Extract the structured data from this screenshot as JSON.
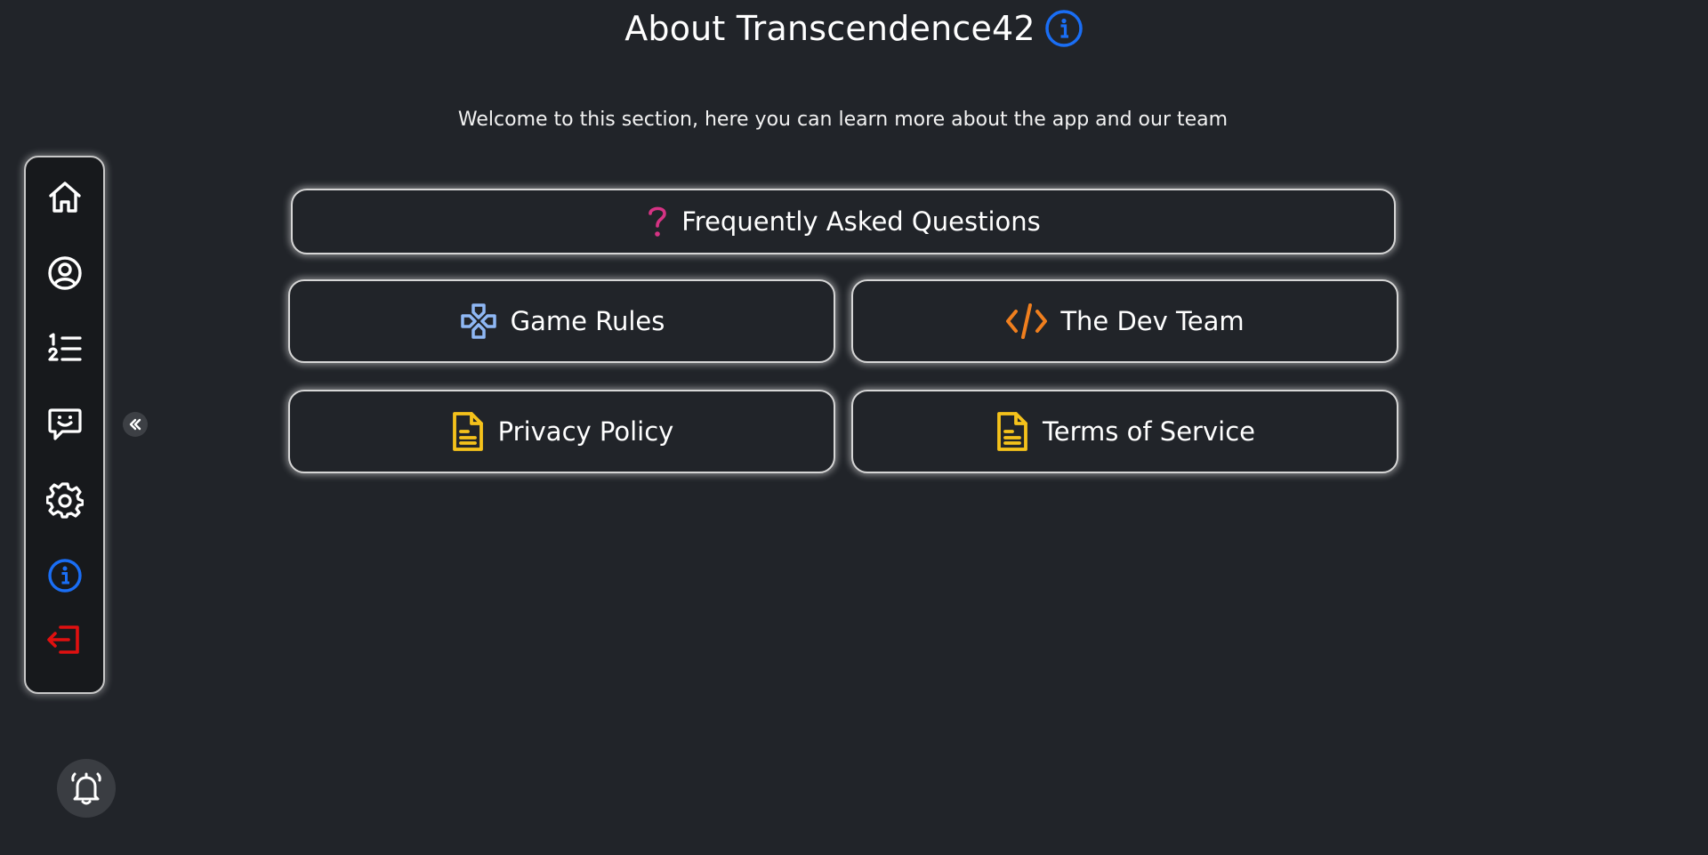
{
  "header": {
    "title": "About Transcendence42",
    "title_icon": "info-circle-icon",
    "subtitle": "Welcome to this section, here you can learn more about the app and our team"
  },
  "cards": {
    "faq": {
      "label": "Frequently Asked Questions",
      "icon": "question-mark-icon",
      "color": "#d63384"
    },
    "game_rules": {
      "label": "Game Rules",
      "icon": "gamepad-icon",
      "color": "#8fb8f5"
    },
    "dev_team": {
      "label": "The Dev Team",
      "icon": "code-icon",
      "color": "#f07f1e"
    },
    "privacy": {
      "label": "Privacy Policy",
      "icon": "document-icon",
      "color": "#f5c21b"
    },
    "terms": {
      "label": "Terms of Service",
      "icon": "document-icon",
      "color": "#f5c21b"
    }
  },
  "sidebar": {
    "items": [
      {
        "name": "home",
        "icon": "home-icon",
        "color": "#ffffff"
      },
      {
        "name": "profile",
        "icon": "user-circle-icon",
        "color": "#ffffff"
      },
      {
        "name": "leaderboard",
        "icon": "ordered-list-icon",
        "color": "#ffffff"
      },
      {
        "name": "chat",
        "icon": "chat-smile-icon",
        "color": "#ffffff"
      },
      {
        "name": "settings",
        "icon": "gear-icon",
        "color": "#ffffff"
      },
      {
        "name": "about",
        "icon": "info-circle-icon",
        "color": "#1a6ef5",
        "active": true
      },
      {
        "name": "logout",
        "icon": "logout-icon",
        "color": "#e01010"
      }
    ]
  },
  "colors": {
    "background": "#212429",
    "accent_blue": "#1a6ef5",
    "logout_red": "#e01010"
  }
}
